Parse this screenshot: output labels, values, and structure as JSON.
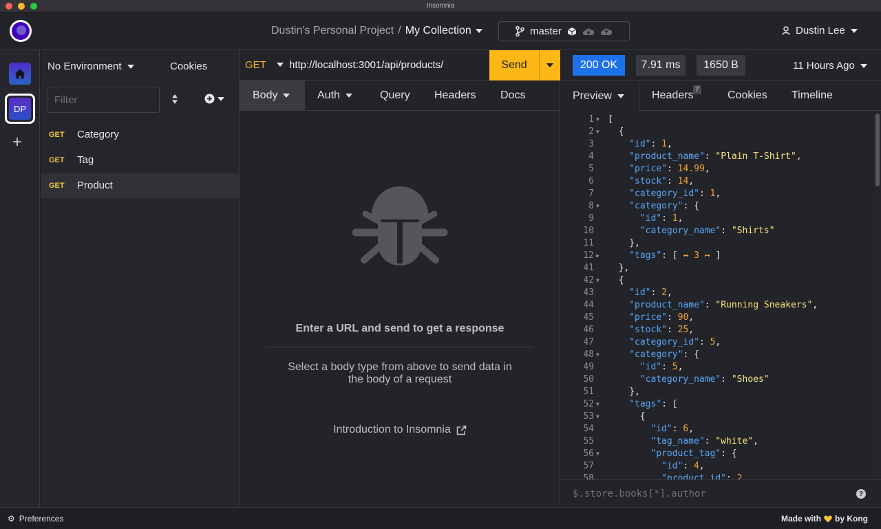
{
  "window": {
    "title": "Insomnia"
  },
  "header": {
    "project": "Dustin's Personal Project",
    "separator": "/",
    "collection": "My Collection",
    "branch": "master",
    "user": "Dustin Lee"
  },
  "rail": {
    "workspace_initials": "DP",
    "add_label": "+"
  },
  "sidebar": {
    "environment": "No Environment",
    "cookies": "Cookies",
    "filter_placeholder": "Filter",
    "requests": [
      {
        "method": "GET",
        "name": "Category"
      },
      {
        "method": "GET",
        "name": "Tag"
      },
      {
        "method": "GET",
        "name": "Product"
      }
    ]
  },
  "request": {
    "method": "GET",
    "url": "http://localhost:3001/api/products/",
    "send": "Send",
    "tabs": [
      "Body",
      "Auth",
      "Query",
      "Headers",
      "Docs"
    ],
    "empty_title": "Enter a URL and send to get a response",
    "empty_sub": "Select a body type from above to send data in the body of a request",
    "intro_link": "Introduction to Insomnia"
  },
  "response": {
    "status": "200 OK",
    "time": "7.91 ms",
    "size": "1650 B",
    "ago": "11 Hours Ago",
    "tabs": [
      "Preview",
      "Headers",
      "Cookies",
      "Timeline"
    ],
    "headers_count": "7",
    "filter_placeholder": "$.store.books[*].author",
    "help": "?",
    "lines": [
      {
        "n": "1",
        "fold": "▼",
        "indent": 0,
        "text": "["
      },
      {
        "n": "2",
        "fold": "▼",
        "indent": 1,
        "text": "{"
      },
      {
        "n": "3",
        "fold": "",
        "indent": 2,
        "key": "id",
        "num": "1",
        "end": ","
      },
      {
        "n": "4",
        "fold": "",
        "indent": 2,
        "key": "product_name",
        "str": "Plain T-Shirt",
        "end": ","
      },
      {
        "n": "5",
        "fold": "",
        "indent": 2,
        "key": "price",
        "num": "14.99",
        "end": ","
      },
      {
        "n": "6",
        "fold": "",
        "indent": 2,
        "key": "stock",
        "num": "14",
        "end": ","
      },
      {
        "n": "7",
        "fold": "",
        "indent": 2,
        "key": "category_id",
        "num": "1",
        "end": ","
      },
      {
        "n": "8",
        "fold": "▼",
        "indent": 2,
        "key": "category",
        "open": "{"
      },
      {
        "n": "9",
        "fold": "",
        "indent": 3,
        "key": "id",
        "num": "1",
        "end": ","
      },
      {
        "n": "10",
        "fold": "",
        "indent": 3,
        "key": "category_name",
        "str": "Shirts"
      },
      {
        "n": "11",
        "fold": "",
        "indent": 2,
        "text": "},"
      },
      {
        "n": "12",
        "fold": "▶",
        "indent": 2,
        "key": "tags",
        "collapsed": "↔ 3 ↦"
      },
      {
        "n": "41",
        "fold": "",
        "indent": 1,
        "text": "},"
      },
      {
        "n": "42",
        "fold": "▼",
        "indent": 1,
        "text": "{"
      },
      {
        "n": "43",
        "fold": "",
        "indent": 2,
        "key": "id",
        "num": "2",
        "end": ","
      },
      {
        "n": "44",
        "fold": "",
        "indent": 2,
        "key": "product_name",
        "str": "Running Sneakers",
        "end": ","
      },
      {
        "n": "45",
        "fold": "",
        "indent": 2,
        "key": "price",
        "num": "90",
        "end": ","
      },
      {
        "n": "46",
        "fold": "",
        "indent": 2,
        "key": "stock",
        "num": "25",
        "end": ","
      },
      {
        "n": "47",
        "fold": "",
        "indent": 2,
        "key": "category_id",
        "num": "5",
        "end": ","
      },
      {
        "n": "48",
        "fold": "▼",
        "indent": 2,
        "key": "category",
        "open": "{"
      },
      {
        "n": "49",
        "fold": "",
        "indent": 3,
        "key": "id",
        "num": "5",
        "end": ","
      },
      {
        "n": "50",
        "fold": "",
        "indent": 3,
        "key": "category_name",
        "str": "Shoes"
      },
      {
        "n": "51",
        "fold": "",
        "indent": 2,
        "text": "},"
      },
      {
        "n": "52",
        "fold": "▼",
        "indent": 2,
        "key": "tags",
        "open": "["
      },
      {
        "n": "53",
        "fold": "▼",
        "indent": 3,
        "text": "{"
      },
      {
        "n": "54",
        "fold": "",
        "indent": 4,
        "key": "id",
        "num": "6",
        "end": ","
      },
      {
        "n": "55",
        "fold": "",
        "indent": 4,
        "key": "tag_name",
        "str": "white",
        "end": ","
      },
      {
        "n": "56",
        "fold": "▼",
        "indent": 4,
        "key": "product_tag",
        "open": "{"
      },
      {
        "n": "57",
        "fold": "",
        "indent": 5,
        "key": "id",
        "num": "4",
        "end": ","
      },
      {
        "n": "58",
        "fold": "",
        "indent": 5,
        "key": "product_id",
        "num": "2",
        "end": ","
      }
    ]
  },
  "footer": {
    "preferences": "Preferences",
    "made_with": "Made with",
    "by": "by Kong"
  },
  "colors": {
    "accent": "#fdb815",
    "status_ok": "#1d72e8",
    "method_get": "#f0c340",
    "json_key": "#59a6f5",
    "json_string": "#f8e37a",
    "json_number": "#f0a63a"
  },
  "icons": [
    "home-icon",
    "branch-icon",
    "cube-icon",
    "cloud-download-icon",
    "cloud-upload-icon",
    "user-icon",
    "sort-icon",
    "plus-circle-icon",
    "bug-icon",
    "external-link-icon",
    "gear-icon",
    "heart-icon",
    "help-icon"
  ]
}
